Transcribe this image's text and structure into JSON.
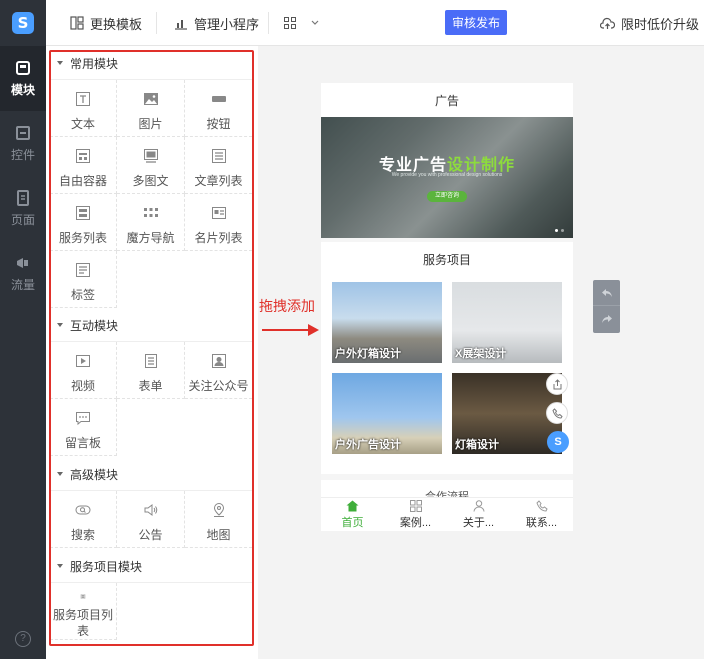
{
  "nav": {
    "items": [
      {
        "label": "模块",
        "active": true
      },
      {
        "label": "控件"
      },
      {
        "label": "页面"
      },
      {
        "label": "流量"
      }
    ],
    "help": "?"
  },
  "topbar": {
    "change_template": "更换模板",
    "manage_miniprogram": "管理小程序",
    "publish": "审核发布",
    "upgrade": "限时低价升级"
  },
  "panel": {
    "sections": [
      {
        "title": "常用模块",
        "items": [
          "文本",
          "图片",
          "按钮",
          "自由容器",
          "多图文",
          "文章列表",
          "服务列表",
          "魔方导航",
          "名片列表",
          "标签"
        ]
      },
      {
        "title": "互动模块",
        "items": [
          "视频",
          "表单",
          "关注公众号",
          "留言板"
        ]
      },
      {
        "title": "高级模块",
        "items": [
          "搜索",
          "公告",
          "地图"
        ]
      },
      {
        "title": "服务项目模块",
        "items": [
          "服务项目列表"
        ]
      }
    ]
  },
  "drag_hint": "拖拽添加",
  "preview": {
    "ad_title": "广告",
    "banner": {
      "title_white": "专业广告",
      "title_green": "设计制作",
      "subtitle": "We provide you with professional design solutions",
      "button": "立即咨询"
    },
    "service_title": "服务项目",
    "tiles": [
      "户外灯箱设计",
      "X展架设计",
      "户外广告设计",
      "灯箱设计"
    ],
    "flow_title": "合作流程",
    "tabs": [
      "首页",
      "案例...",
      "关于...",
      "联系..."
    ]
  },
  "colors": {
    "accent": "#4a6cf7",
    "highlight": "#e0302a",
    "brand_green": "#3fae3a",
    "nav_bg": "#2d3239"
  }
}
